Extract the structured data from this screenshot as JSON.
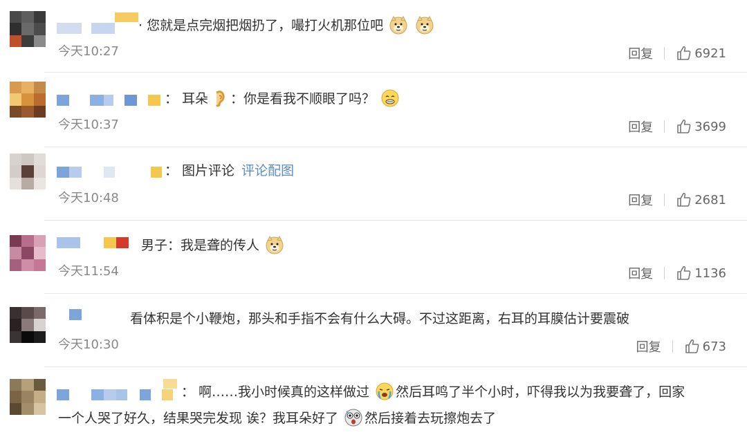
{
  "comments": [
    {
      "text": "·  您就是点完烟把烟扔了，嘬打火机那位吧",
      "emojis": [
        "doge-emoji",
        "doge-emoji"
      ],
      "time": "今天10:27",
      "reply": "回复",
      "likes": "6921"
    },
    {
      "text_before": "：  耳朵",
      "text_after": "：你是看我不顺眼了吗？",
      "emojis": [
        "ear-emoji",
        "silent-emoji"
      ],
      "time": "今天10:37",
      "reply": "回复",
      "likes": "3699"
    },
    {
      "text": "：  图片评论",
      "link": "评论配图",
      "time": "今天10:48",
      "reply": "回复",
      "likes": "2681"
    },
    {
      "text": "男子：我是聋的传人",
      "emojis": [
        "doge-emoji"
      ],
      "time": "今天11:54",
      "reply": "回复",
      "likes": "1136"
    },
    {
      "text": "看体积是个小鞭炮，那头和手指不会有什么大碍。不过这距离，右耳的耳膜估计要震破",
      "time": "今天10:30",
      "reply": "回复",
      "likes": "673"
    },
    {
      "line1_before": "：  啊……我小时候真的这样做过",
      "line1_after": "然后耳鸣了半个小时，吓得我以为我要聋了，回家",
      "line2_before": "一个人哭了好久，结果哭完发现 诶？我耳朵好了",
      "line2_after": "然后接着去玩擦炮去了",
      "emojis": [
        "crying-emoji",
        "scared-emoji"
      ]
    }
  ],
  "colors": {
    "text": "#333333",
    "time": "#888888",
    "link": "#5b8cc7",
    "divider": "#e6e6e6"
  }
}
